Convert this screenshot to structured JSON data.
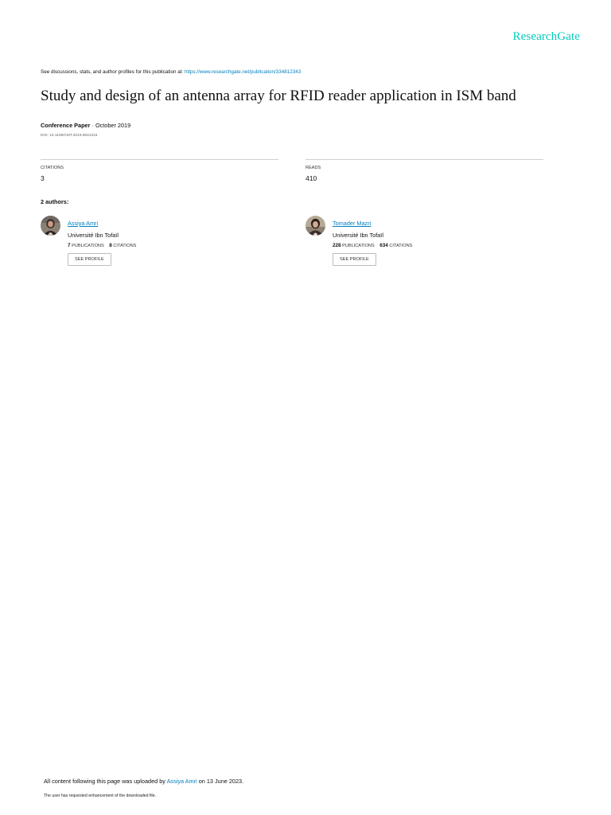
{
  "brand": "ResearchGate",
  "header": {
    "discuss_text": "See discussions, stats, and author profiles for this publication at: ",
    "publication_url": "https://www.researchgate.net/publication/334812343"
  },
  "publication": {
    "title": "Study and design of an antenna array for RFID reader application in ISM band",
    "type": "Conference Paper",
    "date_suffix": " · October 2019",
    "doi": "DOI: 10.1109/CMT.2019.8931316"
  },
  "stats": {
    "citations_label": "CITATIONS",
    "citations_value": "3",
    "reads_label": "READS",
    "reads_value": "410"
  },
  "authors_heading": "2 authors:",
  "authors": [
    {
      "name": "Assiya Amri",
      "institution": "Université Ibn Tofaïl",
      "publications": "7",
      "publications_label": "PUBLICATIONS",
      "citations": "8",
      "citations_label": "CITATIONS",
      "button": "SEE PROFILE"
    },
    {
      "name": "Tomader Mazri",
      "institution": "Université Ibn Tofaïl",
      "publications": "228",
      "publications_label": "PUBLICATIONS",
      "citations": "634",
      "citations_label": "CITATIONS",
      "button": "SEE PROFILE"
    }
  ],
  "footer": {
    "uploaded_prefix": "All content following this page was uploaded by ",
    "uploader": "Assiya Amri",
    "uploaded_suffix": " on 13 June 2023.",
    "note": "The user has requested enhancement of the downloaded file."
  },
  "colors": {
    "brand": "#00ccbb",
    "link": "#0080c0",
    "divider": "#cfcfcf"
  }
}
